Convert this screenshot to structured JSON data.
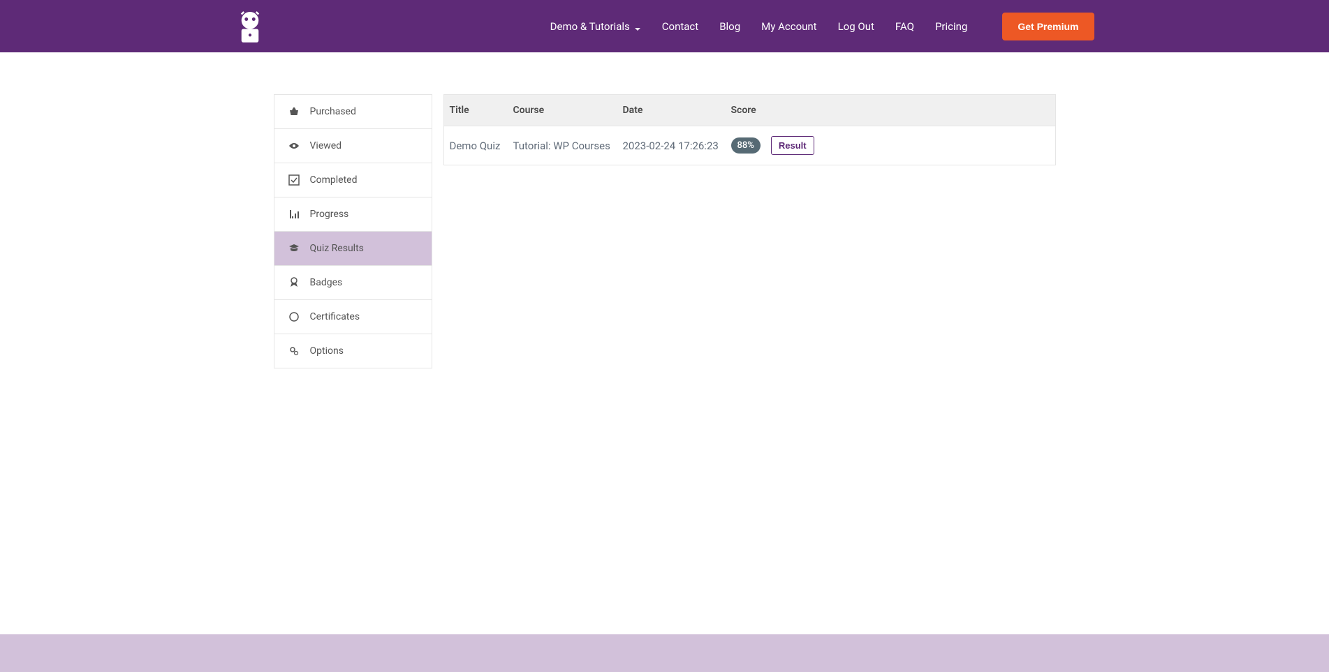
{
  "nav": {
    "items": [
      {
        "label": "Demo & Tutorials",
        "dropdown": true
      },
      {
        "label": "Contact",
        "dropdown": false
      },
      {
        "label": "Blog",
        "dropdown": false
      },
      {
        "label": "My Account",
        "dropdown": false
      },
      {
        "label": "Log Out",
        "dropdown": false
      },
      {
        "label": "FAQ",
        "dropdown": false
      },
      {
        "label": "Pricing",
        "dropdown": false
      }
    ],
    "premium_label": "Get Premium"
  },
  "sidebar": {
    "items": [
      {
        "label": "Purchased",
        "icon": "basket-icon",
        "active": false
      },
      {
        "label": "Viewed",
        "icon": "eye-icon",
        "active": false
      },
      {
        "label": "Completed",
        "icon": "check-square-icon",
        "active": false
      },
      {
        "label": "Progress",
        "icon": "chart-icon",
        "active": false
      },
      {
        "label": "Quiz Results",
        "icon": "graduation-icon",
        "active": true
      },
      {
        "label": "Badges",
        "icon": "ribbon-icon",
        "active": false
      },
      {
        "label": "Certificates",
        "icon": "certificate-icon",
        "active": false
      },
      {
        "label": "Options",
        "icon": "gears-icon",
        "active": false
      }
    ]
  },
  "table": {
    "headers": {
      "title": "Title",
      "course": "Course",
      "date": "Date",
      "score": "Score"
    },
    "rows": [
      {
        "title": "Demo Quiz",
        "course": "Tutorial: WP Courses",
        "date": "2023-02-24 17:26:23",
        "score": "88%",
        "result_label": "Result"
      }
    ]
  }
}
